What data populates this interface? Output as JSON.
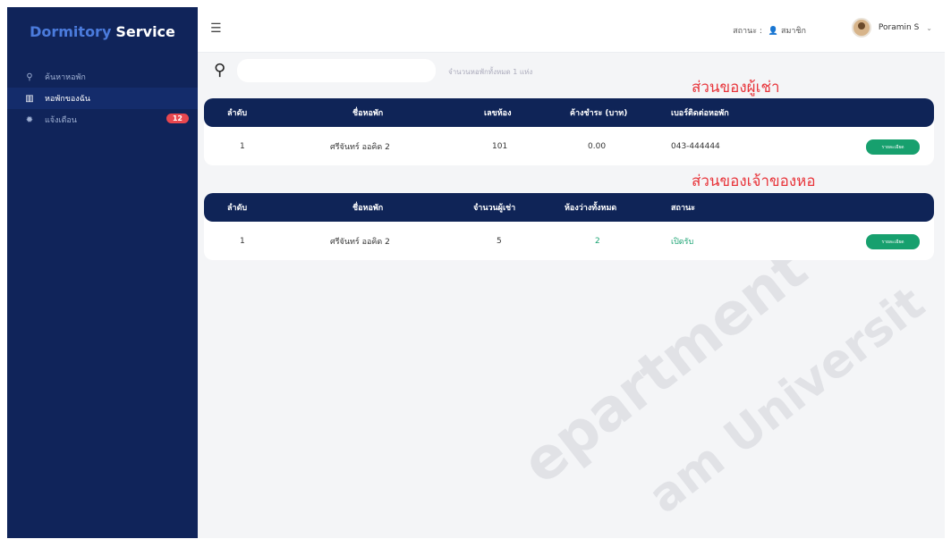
{
  "sidebar": {
    "brand_part1": "Dormitory",
    "brand_part2": "Service",
    "items": [
      {
        "icon": "search-icon",
        "label": "ค้นหาหอพัก"
      },
      {
        "icon": "building-icon",
        "label": "หอพักของฉัน"
      },
      {
        "icon": "bell-icon",
        "label": "แจ้งเตือน",
        "badge": "12"
      }
    ]
  },
  "header": {
    "status_label": "สถานะ :",
    "status_value": "สมาชิก",
    "user_name": "Poramin S"
  },
  "search": {
    "placeholder": "",
    "count_text": "จำนวนหอพักทั้งหมด 1 แห่ง"
  },
  "notes": {
    "tenant": "ส่วนของผู้เช่า",
    "owner": "ส่วนของเจ้าของหอ"
  },
  "tenant_table": {
    "columns": [
      "ลำดับ",
      "ชื่อหอพัก",
      "เลขห้อง",
      "ค้างชำระ (บาท)",
      "เบอร์ติดต่อหอพัก"
    ],
    "rows": [
      {
        "no": "1",
        "name": "ศรีจันทร์ ออคิด 2",
        "room": "101",
        "due": "0.00",
        "phone": "043-444444",
        "button": "รายละเอียด"
      }
    ]
  },
  "owner_table": {
    "columns": [
      "ลำดับ",
      "ชื่อหอพัก",
      "จำนวนผู้เช่า",
      "ห้องว่างทั้งหมด",
      "สถานะ"
    ],
    "rows": [
      {
        "no": "1",
        "name": "ศรีจันทร์ ออคิด 2",
        "tenants": "5",
        "vacant": "2",
        "status": "เปิดรับ",
        "button": "รายละเอียด"
      }
    ]
  },
  "watermark": {
    "line1": "epartment",
    "line2": "am Universit"
  },
  "colors": {
    "sidebar": "#10245a",
    "table_header": "#0f2457",
    "accent_green": "#17a06e",
    "note_red": "#e8343a"
  }
}
